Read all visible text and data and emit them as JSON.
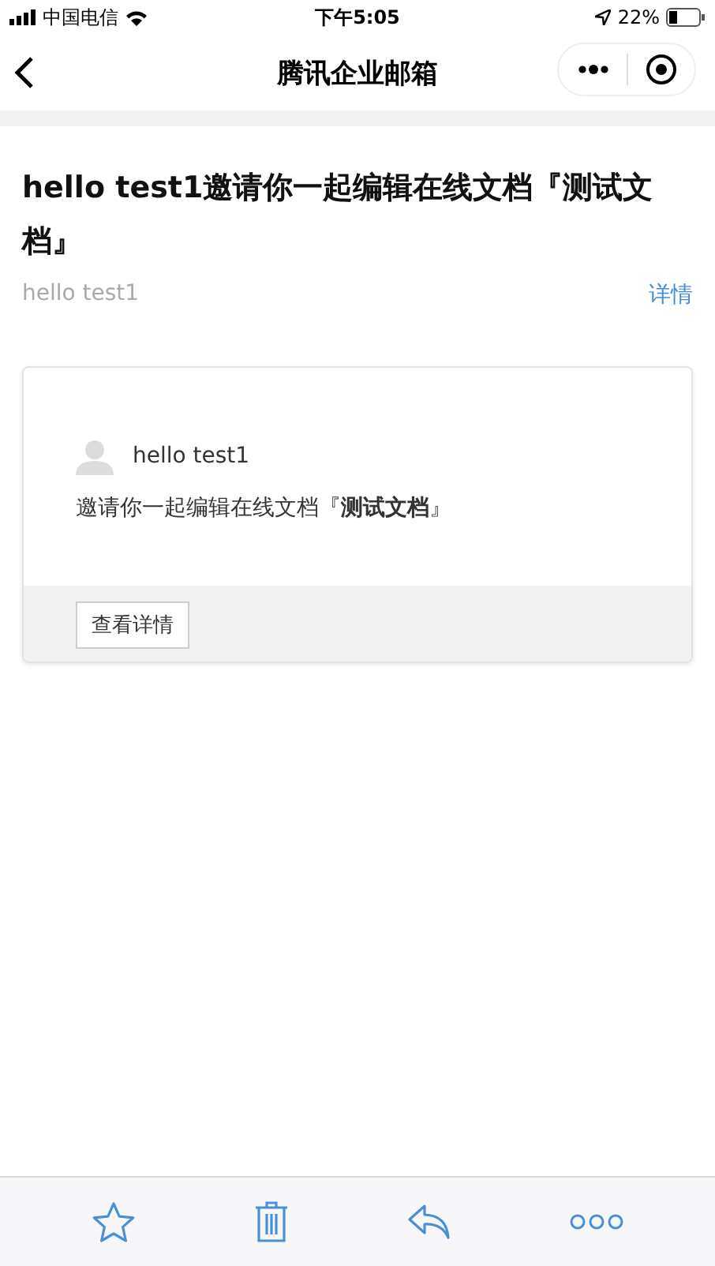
{
  "status_bar": {
    "carrier": "中国电信",
    "time": "下午5:05",
    "battery": "22%"
  },
  "nav": {
    "title": "腾讯企业邮箱"
  },
  "mail": {
    "subject": "hello test1邀请你一起编辑在线文档『测试文档』",
    "sender": "hello test1",
    "details_link": "详情"
  },
  "card": {
    "sender": "hello test1",
    "message": "邀请你一起编辑在线文档『**测试文档**』",
    "button": "查看详情"
  },
  "toolbar": [
    {
      "kind": "star"
    },
    {
      "kind": "trash"
    },
    {
      "kind": "reply"
    },
    {
      "kind": "more"
    }
  ]
}
